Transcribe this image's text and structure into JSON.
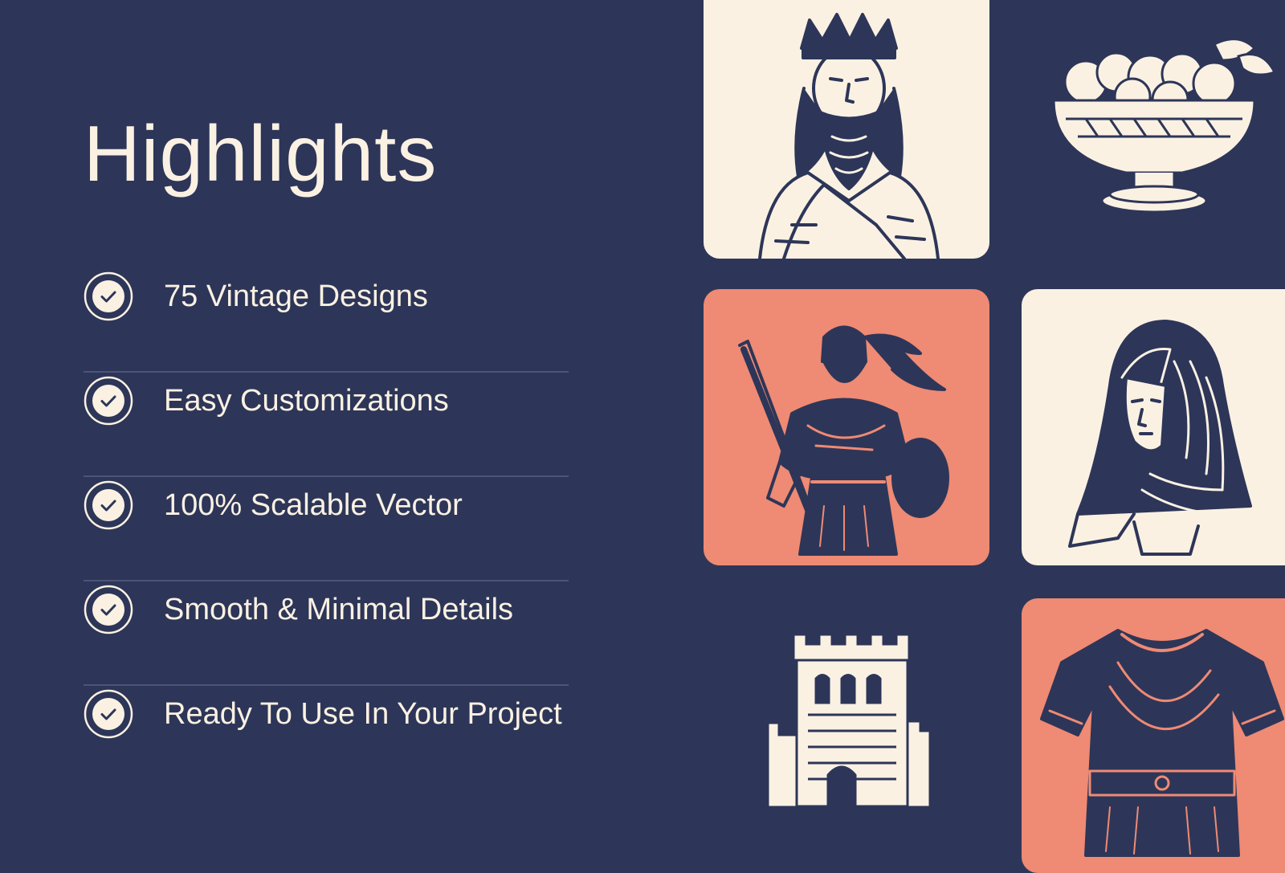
{
  "heading": "Highlights",
  "features": [
    {
      "label": "75 Vintage Designs"
    },
    {
      "label": "Easy Customizations"
    },
    {
      "label": "100% Scalable Vector"
    },
    {
      "label": "Smooth & Minimal Details"
    },
    {
      "label": "Ready To Use In Your Project"
    }
  ],
  "colors": {
    "background": "#2d3658",
    "cream": "#fbf1e3",
    "coral": "#ef8a74",
    "divider": "#4c5577"
  },
  "illustrations": [
    {
      "name": "king-illustration",
      "tile": "cream"
    },
    {
      "name": "fruit-bowl-illustration",
      "tile": "none"
    },
    {
      "name": "warrior-illustration",
      "tile": "coral"
    },
    {
      "name": "veiled-woman-illustration",
      "tile": "cream"
    },
    {
      "name": "castle-tower-illustration",
      "tile": "none"
    },
    {
      "name": "tunic-illustration",
      "tile": "coral"
    }
  ]
}
